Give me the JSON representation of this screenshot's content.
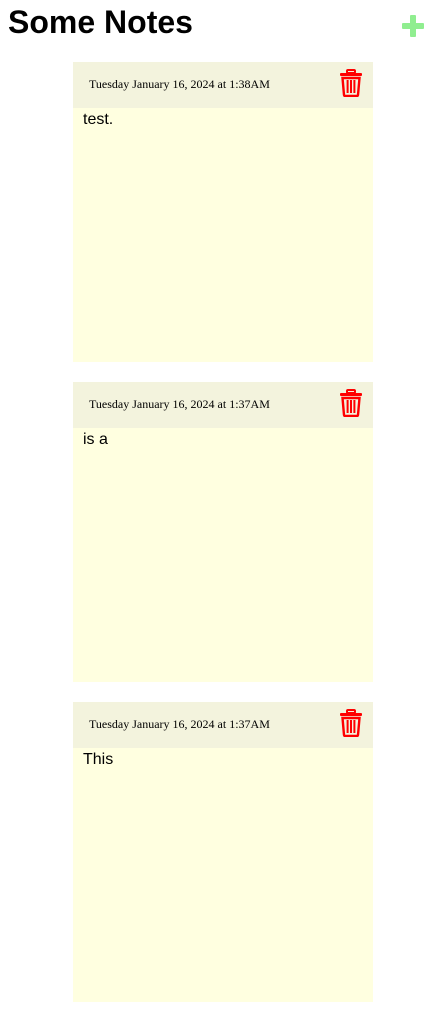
{
  "header": {
    "title": "Some Notes",
    "add_icon": "plus-icon",
    "add_color": "#90ee90"
  },
  "colors": {
    "note_background": "#ffffe0",
    "note_header_background": "#f3f3dd",
    "delete_icon": "#ff0000"
  },
  "notes": [
    {
      "date": "Tuesday January 16, 2024 at 1:38AM",
      "text": "test.",
      "delete_icon": "trash-icon"
    },
    {
      "date": "Tuesday January 16, 2024 at 1:37AM",
      "text": "is a",
      "delete_icon": "trash-icon"
    },
    {
      "date": "Tuesday January 16, 2024 at 1:37AM",
      "text": "This",
      "delete_icon": "trash-icon"
    }
  ]
}
